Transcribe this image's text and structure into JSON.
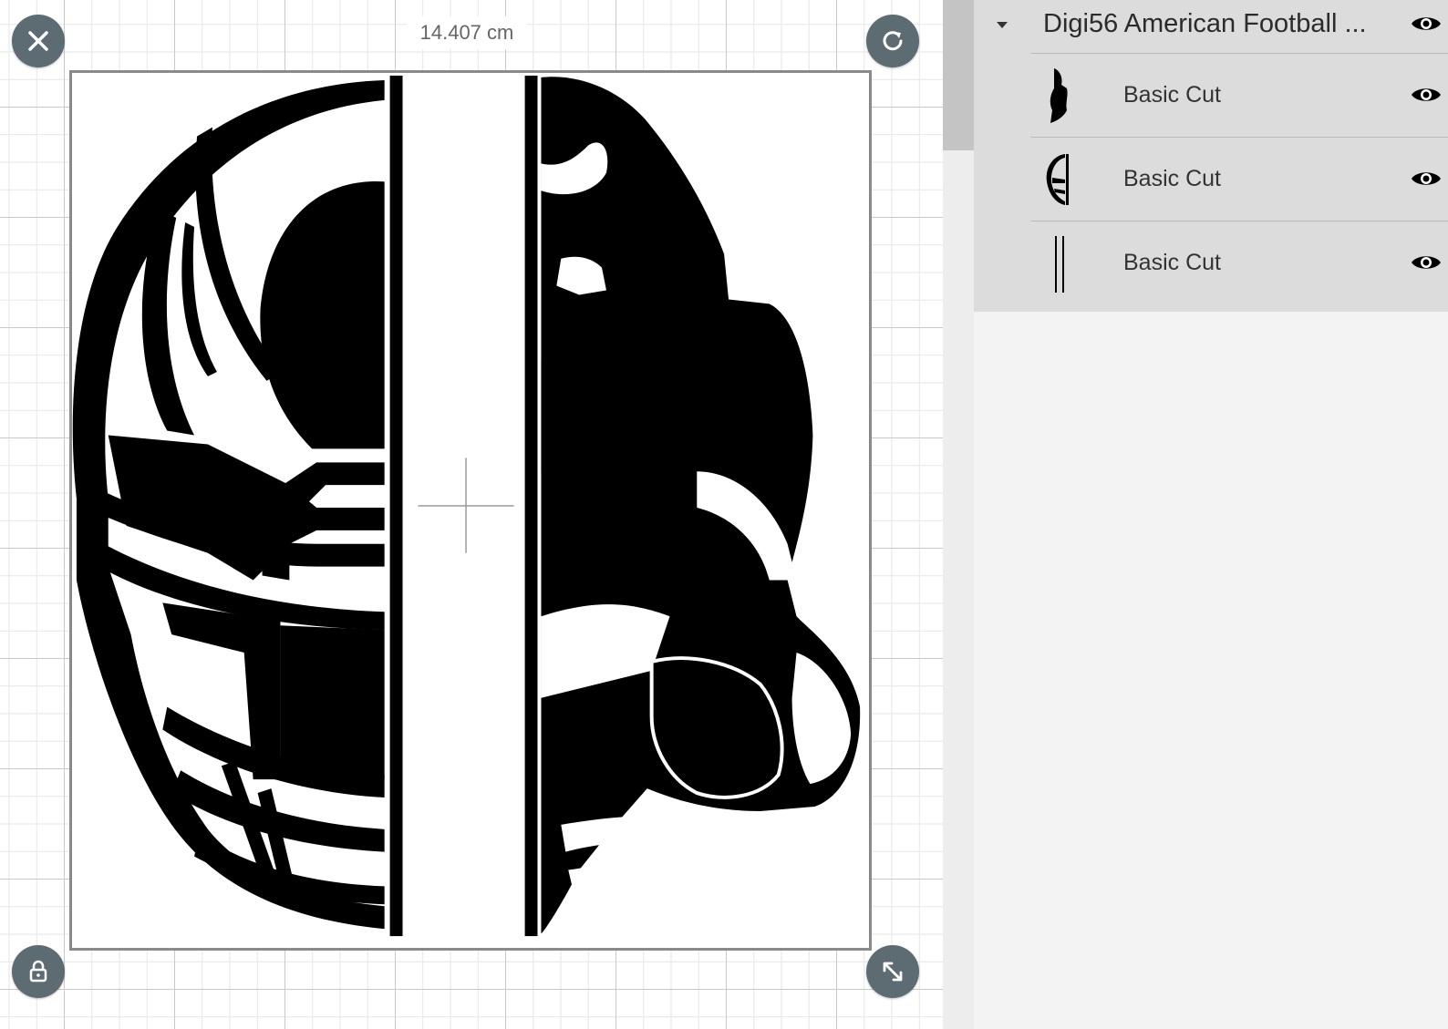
{
  "canvas": {
    "dimension_label": "14.407 cm"
  },
  "handles": {
    "close_icon": "close-icon",
    "rotate_icon": "rotate-icon",
    "lock_icon": "lock-icon",
    "resize_icon": "resize-icon"
  },
  "layers": {
    "group": {
      "title": "Digi56 American Football ...",
      "expanded": true
    },
    "items": [
      {
        "label": "Basic Cut",
        "thumbnail": "player-silhouette"
      },
      {
        "label": "Basic Cut",
        "thumbnail": "helmet-silhouette"
      },
      {
        "label": "Basic Cut",
        "thumbnail": "vertical-lines"
      }
    ]
  }
}
